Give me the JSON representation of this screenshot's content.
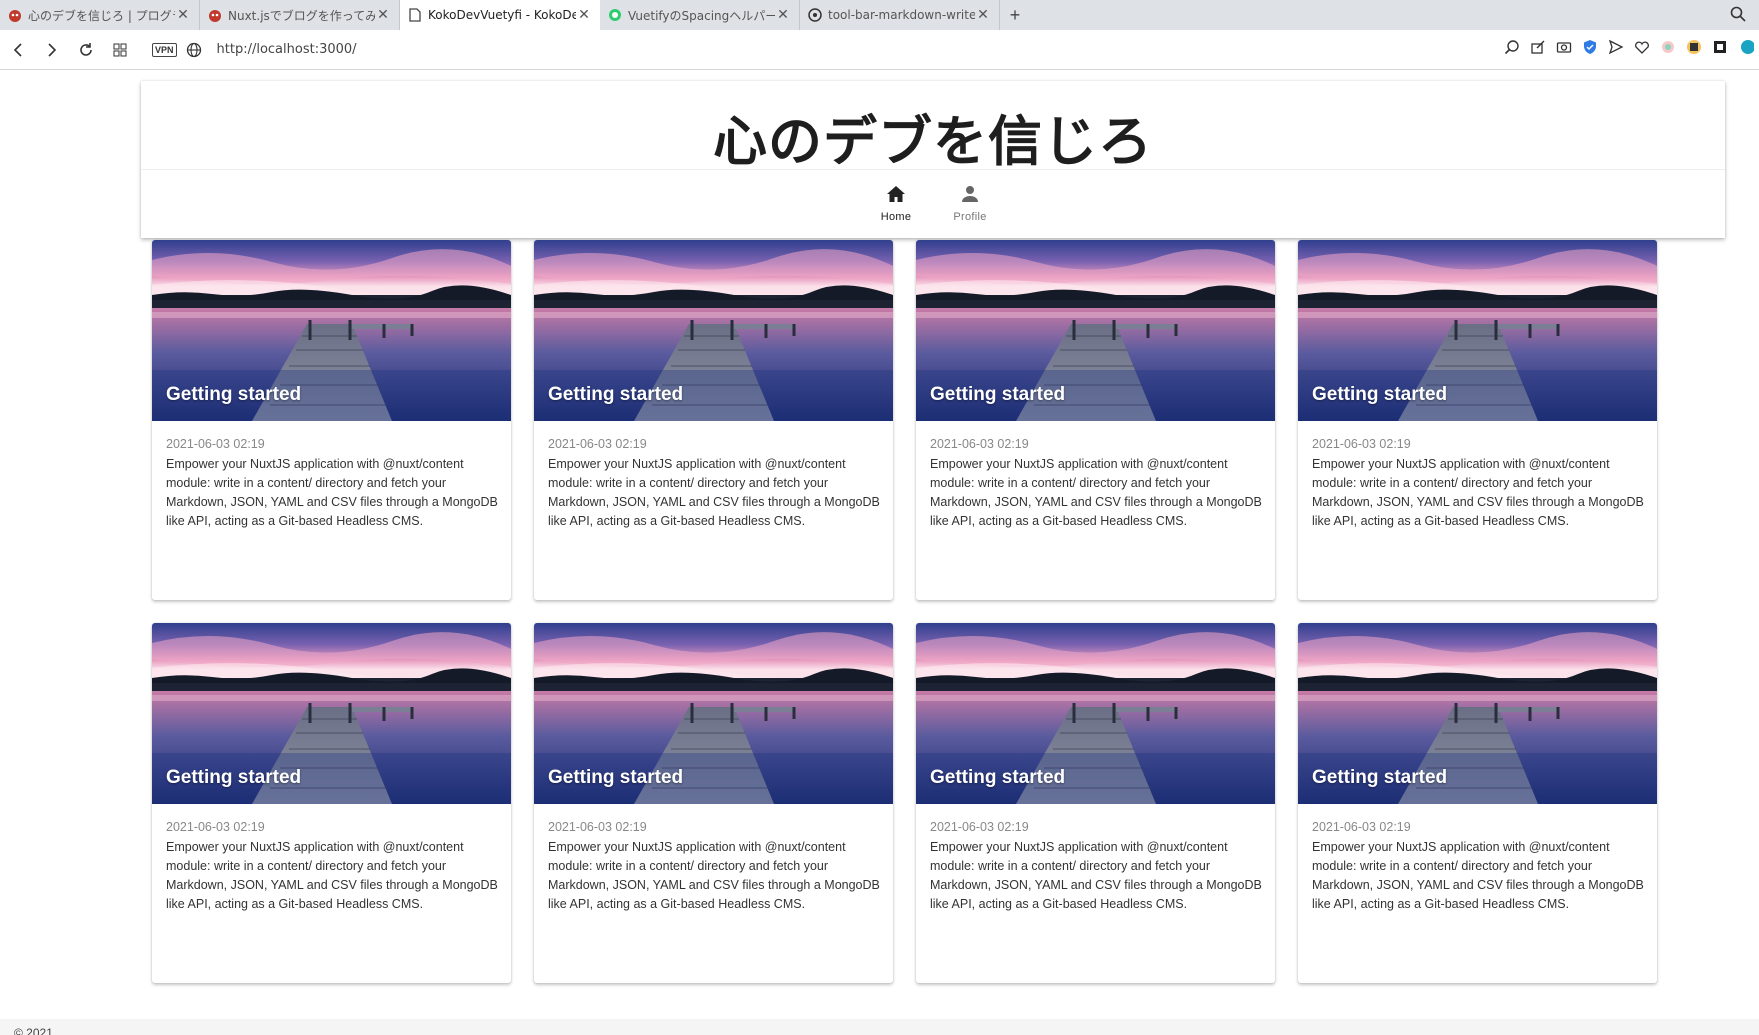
{
  "browser": {
    "tabs": [
      {
        "title": "心のデブを信じろ | プログラムや",
        "active": false,
        "favicon": "cat-icon"
      },
      {
        "title": "Nuxt.jsでブログを作ってみる。",
        "active": false,
        "favicon": "cat-icon"
      },
      {
        "title": "KokoDevVuetyfi - KokoDev",
        "active": true,
        "favicon": "page-icon"
      },
      {
        "title": "VuetifyのSpacingヘルパーでM",
        "active": false,
        "favicon": "vuetify-icon"
      },
      {
        "title": "tool-bar-markdown-writer",
        "active": false,
        "favicon": "github-icon"
      }
    ],
    "url": "http://localhost:3000/",
    "vpn_label": "VPN"
  },
  "site": {
    "title": "心のデブを信じろ",
    "nav": [
      {
        "label": "Home",
        "icon": "home-icon",
        "active": true
      },
      {
        "label": "Profile",
        "icon": "person-icon",
        "active": false
      }
    ]
  },
  "cards": [
    {
      "title": "Getting started",
      "date": "2021-06-03 02:19",
      "description": "Empower your NuxtJS application with @nuxt/content module: write in a content/ directory and fetch your Markdown, JSON, YAML and CSV files through a MongoDB like API, acting as a Git-based Headless CMS."
    },
    {
      "title": "Getting started",
      "date": "2021-06-03 02:19",
      "description": "Empower your NuxtJS application with @nuxt/content module: write in a content/ directory and fetch your Markdown, JSON, YAML and CSV files through a MongoDB like API, acting as a Git-based Headless CMS."
    },
    {
      "title": "Getting started",
      "date": "2021-06-03 02:19",
      "description": "Empower your NuxtJS application with @nuxt/content module: write in a content/ directory and fetch your Markdown, JSON, YAML and CSV files through a MongoDB like API, acting as a Git-based Headless CMS."
    },
    {
      "title": "Getting started",
      "date": "2021-06-03 02:19",
      "description": "Empower your NuxtJS application with @nuxt/content module: write in a content/ directory and fetch your Markdown, JSON, YAML and CSV files through a MongoDB like API, acting as a Git-based Headless CMS."
    },
    {
      "title": "Getting started",
      "date": "2021-06-03 02:19",
      "description": "Empower your NuxtJS application with @nuxt/content module: write in a content/ directory and fetch your Markdown, JSON, YAML and CSV files through a MongoDB like API, acting as a Git-based Headless CMS."
    },
    {
      "title": "Getting started",
      "date": "2021-06-03 02:19",
      "description": "Empower your NuxtJS application with @nuxt/content module: write in a content/ directory and fetch your Markdown, JSON, YAML and CSV files through a MongoDB like API, acting as a Git-based Headless CMS."
    },
    {
      "title": "Getting started",
      "date": "2021-06-03 02:19",
      "description": "Empower your NuxtJS application with @nuxt/content module: write in a content/ directory and fetch your Markdown, JSON, YAML and CSV files through a MongoDB like API, acting as a Git-based Headless CMS."
    },
    {
      "title": "Getting started",
      "date": "2021-06-03 02:19",
      "description": "Empower your NuxtJS application with @nuxt/content module: write in a content/ directory and fetch your Markdown, JSON, YAML and CSV files through a MongoDB like API, acting as a Git-based Headless CMS."
    }
  ],
  "footer": {
    "text": "© 2021"
  },
  "colors": {
    "accent": "#1976d2",
    "text": "#1e1e1e"
  }
}
